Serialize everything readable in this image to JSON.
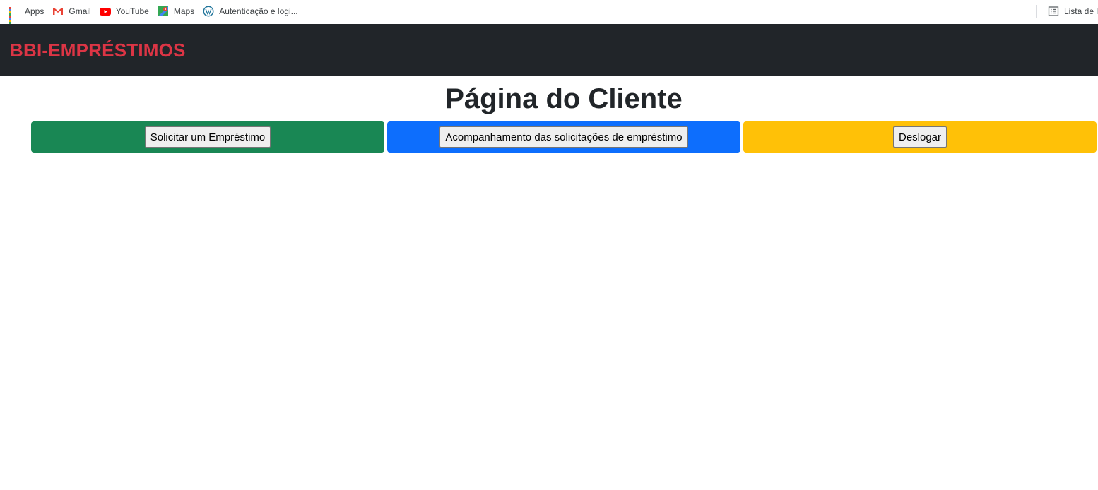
{
  "bookmarks": {
    "items": [
      {
        "label": "Apps",
        "icon": "apps-grid-icon"
      },
      {
        "label": "Gmail",
        "icon": "gmail-icon"
      },
      {
        "label": "YouTube",
        "icon": "youtube-icon"
      },
      {
        "label": "Maps",
        "icon": "maps-icon"
      },
      {
        "label": "Autenticação e logi...",
        "icon": "wordpress-icon"
      }
    ],
    "reading_list": {
      "label": "Lista de l",
      "icon": "reading-list-icon"
    }
  },
  "navbar": {
    "brand": "BBI-EMPRÉSTIMOS",
    "background": "#212529",
    "brand_color": "#dc3545"
  },
  "main": {
    "title": "Página do Cliente",
    "actions": [
      {
        "label": "Solicitar um Empréstimo",
        "color": "#198754"
      },
      {
        "label": "Acompanhamento das solicitações de empréstimo",
        "color": "#0d6efd"
      },
      {
        "label": "Deslogar",
        "color": "#ffc107"
      }
    ]
  }
}
